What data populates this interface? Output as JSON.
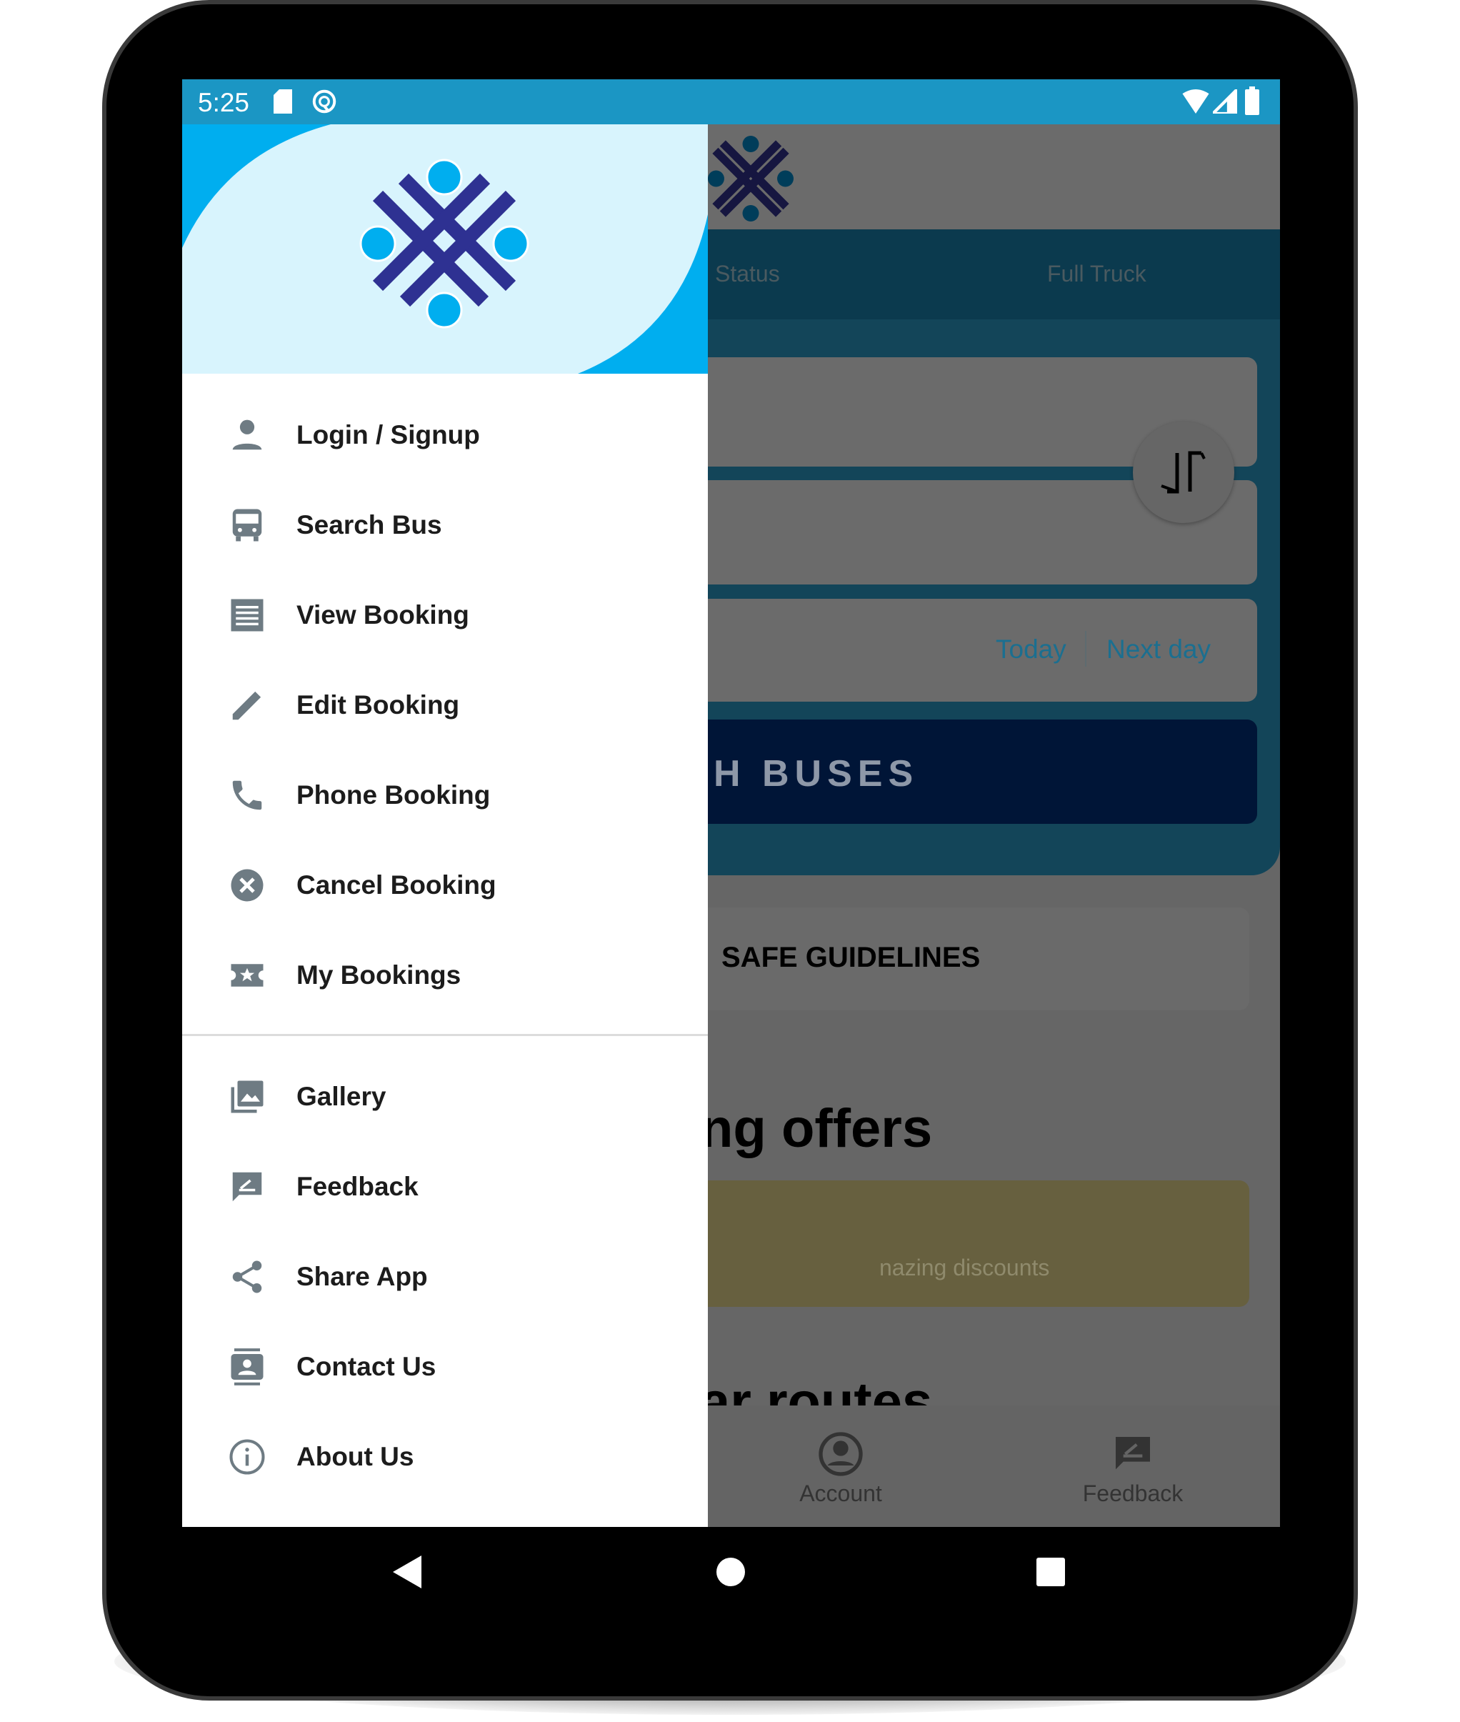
{
  "status_bar": {
    "time": "5:25",
    "icons": [
      "sd-card-icon",
      "sync-icon",
      "wifi-icon",
      "signal-icon",
      "battery-icon"
    ]
  },
  "background": {
    "tabs": [
      "Status",
      "Full Truck"
    ],
    "date_options": [
      "Today",
      "Next day"
    ],
    "search_button": "H BUSES",
    "guidelines": "SAFE GUIDELINES",
    "offers_heading": "ng offers",
    "offer_text": "nazing discounts",
    "routes_heading": "ar routes",
    "bottom_nav": [
      {
        "label": "Account",
        "icon": "account-circle-icon"
      },
      {
        "label": "Feedback",
        "icon": "feedback-icon"
      }
    ]
  },
  "drawer": {
    "items": [
      {
        "label": "Login / Signup",
        "icon": "person-icon"
      },
      {
        "label": "Search Bus",
        "icon": "bus-icon"
      },
      {
        "label": "View Booking",
        "icon": "receipt-icon"
      },
      {
        "label": "Edit Booking",
        "icon": "pencil-icon"
      },
      {
        "label": "Phone Booking",
        "icon": "phone-icon"
      },
      {
        "label": "Cancel Booking",
        "icon": "cancel-icon"
      },
      {
        "label": "My Bookings",
        "icon": "ticket-star-icon"
      }
    ],
    "secondary_items": [
      {
        "label": "Gallery",
        "icon": "gallery-icon"
      },
      {
        "label": "Feedback",
        "icon": "feedback-icon"
      },
      {
        "label": "Share App",
        "icon": "share-icon"
      },
      {
        "label": "Contact Us",
        "icon": "contact-icon"
      },
      {
        "label": "About Us",
        "icon": "info-icon"
      }
    ]
  },
  "colors": {
    "status_bar": "#1b96c4",
    "header_light": "#d8f4fd",
    "header_accent": "#00aeef",
    "logo": "#2e3192",
    "icon": "#6e7b83"
  }
}
